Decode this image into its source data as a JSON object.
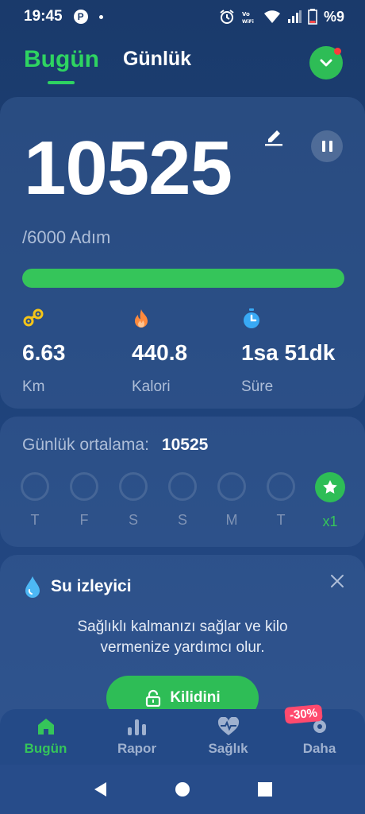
{
  "status_bar": {
    "time": "19:45",
    "battery": "%9",
    "pinterest_glyph": "P",
    "icons": [
      "pinterest-icon",
      "notification-dot-icon",
      "alarm-icon",
      "vowifi-icon",
      "wifi-icon",
      "signal-icon",
      "battery-icon"
    ]
  },
  "header": {
    "tab_today": "Bugün",
    "tab_daily": "Günlük",
    "dropdown_icon": "chevron-down-icon"
  },
  "steps": {
    "value": "10525",
    "goal_text": "/6000 Adım",
    "progress_fraction": 1.0,
    "edit_icon": "pencil-icon",
    "pause_icon": "pause-icon"
  },
  "stats": [
    {
      "value": "6.63",
      "label": "Km",
      "icon": "route-icon"
    },
    {
      "value": "440.8",
      "label": "Kalori",
      "icon": "flame-icon"
    },
    {
      "value": "1sa 51dk",
      "label": "Süre",
      "icon": "stopwatch-icon"
    }
  ],
  "daily_avg": {
    "label": "Günlük ortalama:",
    "value": "10525",
    "days": [
      {
        "label": "T",
        "done": false
      },
      {
        "label": "F",
        "done": false
      },
      {
        "label": "S",
        "done": false
      },
      {
        "label": "S",
        "done": false
      },
      {
        "label": "M",
        "done": false
      },
      {
        "label": "T",
        "done": false
      },
      {
        "label": "x1",
        "done": true
      }
    ]
  },
  "water": {
    "title": "Su izleyici",
    "description": "Sağlıklı kalmanızı sağlar ve kilo vermenize yardımcı olur.",
    "unlock_label": "Kilidini"
  },
  "bottom_nav": {
    "items": [
      {
        "label": "Bugün",
        "icon": "home-icon"
      },
      {
        "label": "Rapor",
        "icon": "bar-chart-icon"
      },
      {
        "label": "Sağlık",
        "icon": "heart-pulse-icon"
      },
      {
        "label": "Daha",
        "icon": "gear-icon",
        "badge": "-30%"
      }
    ]
  },
  "colors": {
    "accent_green": "#35c55a",
    "background": "#1d4178",
    "flame_orange": "#ff8a3d",
    "route_yellow": "#f5c518",
    "stopwatch_blue": "#38a9f5",
    "discount_pink": "#ff4a6e"
  }
}
